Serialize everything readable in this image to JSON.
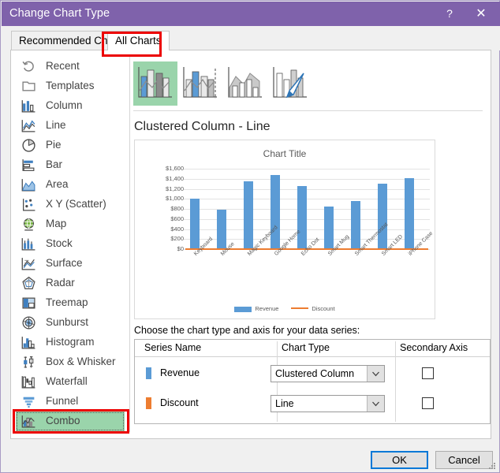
{
  "dialog": {
    "title": "Change Chart Type",
    "help_label": "?",
    "close_label": "✕"
  },
  "tabs": [
    {
      "label": "Recommended Charts",
      "active": false
    },
    {
      "label": "All Charts",
      "active": true
    }
  ],
  "categories": [
    {
      "label": "Recent",
      "icon": "recent-icon"
    },
    {
      "label": "Templates",
      "icon": "templates-icon"
    },
    {
      "label": "Column",
      "icon": "column-chart-icon"
    },
    {
      "label": "Line",
      "icon": "line-chart-icon"
    },
    {
      "label": "Pie",
      "icon": "pie-chart-icon"
    },
    {
      "label": "Bar",
      "icon": "bar-chart-icon"
    },
    {
      "label": "Area",
      "icon": "area-chart-icon"
    },
    {
      "label": "X Y (Scatter)",
      "icon": "scatter-chart-icon"
    },
    {
      "label": "Map",
      "icon": "map-chart-icon"
    },
    {
      "label": "Stock",
      "icon": "stock-chart-icon"
    },
    {
      "label": "Surface",
      "icon": "surface-chart-icon"
    },
    {
      "label": "Radar",
      "icon": "radar-chart-icon"
    },
    {
      "label": "Treemap",
      "icon": "treemap-chart-icon"
    },
    {
      "label": "Sunburst",
      "icon": "sunburst-chart-icon"
    },
    {
      "label": "Histogram",
      "icon": "histogram-chart-icon"
    },
    {
      "label": "Box & Whisker",
      "icon": "box-whisker-chart-icon"
    },
    {
      "label": "Waterfall",
      "icon": "waterfall-chart-icon"
    },
    {
      "label": "Funnel",
      "icon": "funnel-chart-icon"
    },
    {
      "label": "Combo",
      "icon": "combo-chart-icon",
      "selected": true
    }
  ],
  "thumbnails": [
    {
      "name": "clustered-column-line",
      "selected": true
    },
    {
      "name": "clustered-column-line-secondary-axis",
      "selected": false
    },
    {
      "name": "stacked-area-clustered-column",
      "selected": false
    },
    {
      "name": "custom-combination",
      "selected": false
    }
  ],
  "preview": {
    "heading": "Clustered Column - Line"
  },
  "series_section": {
    "caption": "Choose the chart type and axis for your data series:",
    "columns": [
      "Series Name",
      "Chart Type",
      "Secondary Axis"
    ],
    "rows": [
      {
        "name": "Revenue",
        "chart_type": "Clustered Column",
        "secondary_axis": false,
        "color": "#5b9bd5"
      },
      {
        "name": "Discount",
        "chart_type": "Line",
        "secondary_axis": false,
        "color": "#ed7d31"
      }
    ]
  },
  "footer": {
    "ok_label": "OK",
    "cancel_label": "Cancel"
  },
  "colors": {
    "titlebar": "#7f62ab",
    "revenue": "#5b9bd5",
    "discount": "#ed7d31",
    "selection_green": "#9ad4ab",
    "annotation_red": "#ec0000",
    "focus_blue": "#0078d7"
  },
  "chart_data": {
    "type": "bar",
    "title": "Chart Title",
    "xlabel": "",
    "ylabel": "",
    "ylim": [
      0,
      1600
    ],
    "grid": true,
    "legend_position": "bottom",
    "ytick_labels": [
      "$0",
      "$200",
      "$400",
      "$600",
      "$800",
      "$1,000",
      "$1,200",
      "$1,400",
      "$1,600"
    ],
    "yticks": [
      0,
      200,
      400,
      600,
      800,
      1000,
      1200,
      1400,
      1600
    ],
    "categories": [
      "Keyboard",
      "Mouse",
      "Magic Keyboard",
      "Google Home",
      "Echo Dot",
      "Smart Mug",
      "Smart Thermostat",
      "Smart LED",
      "iPhone Case"
    ],
    "series": [
      {
        "name": "Revenue",
        "type": "column",
        "color": "#5b9bd5",
        "values": [
          1000,
          790,
          1350,
          1480,
          1260,
          840,
          960,
          1300,
          1410
        ]
      },
      {
        "name": "Discount",
        "type": "line",
        "color": "#ed7d31",
        "values": [
          10,
          8,
          14,
          15,
          13,
          8,
          10,
          13,
          14
        ]
      }
    ]
  }
}
